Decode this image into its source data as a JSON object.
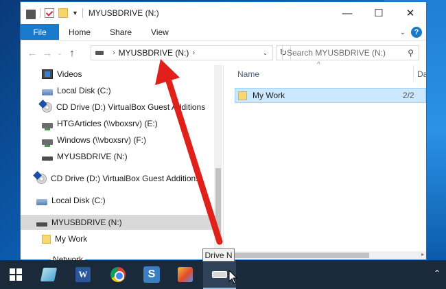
{
  "window": {
    "title": "MYUSBDRIVE (N:)",
    "controls": {
      "minimize": "—",
      "maximize": "☐",
      "close": "✕"
    }
  },
  "ribbon": {
    "file": "File",
    "tabs": [
      "Home",
      "Share",
      "View"
    ],
    "help": "?"
  },
  "navigation": {
    "address_crumb": "MYUSBDRIVE (N:)",
    "search_placeholder": "Search MYUSBDRIVE (N:)"
  },
  "nav_pane": {
    "items": [
      {
        "label": "Videos",
        "icon": "videos-icon"
      },
      {
        "label": "Local Disk (C:)",
        "icon": "local-disk-icon"
      },
      {
        "label": "CD Drive (D:) VirtualBox Guest Additions",
        "icon": "cd-drive-icon"
      },
      {
        "label": "HTGArticles (\\\\vboxsrv) (E:)",
        "icon": "network-drive-icon"
      },
      {
        "label": "Windows (\\\\vboxsrv) (F:)",
        "icon": "network-drive-icon"
      },
      {
        "label": "MYUSBDRIVE (N:)",
        "icon": "usb-drive-icon"
      },
      {
        "label": "CD Drive (D:) VirtualBox Guest Additions",
        "icon": "cd-drive-icon"
      },
      {
        "label": "Local Disk (C:)",
        "icon": "local-disk-icon"
      },
      {
        "label": "MYUSBDRIVE (N:)",
        "icon": "usb-drive-icon",
        "selected": true
      },
      {
        "label": "My Work",
        "icon": "folder-icon"
      },
      {
        "label": "Network",
        "icon": "network-icon"
      }
    ]
  },
  "content": {
    "columns": {
      "name": "Name",
      "date": "Dat"
    },
    "files": [
      {
        "name": "My Work",
        "date": "2/2"
      }
    ]
  },
  "tooltip": "Drive N",
  "taskbar": {
    "apps": [
      "start-button",
      "glass-app",
      "word-app",
      "chrome-app",
      "snagit-app",
      "paint-app",
      "usb-drive-app"
    ]
  },
  "colors": {
    "accent": "#1979ca",
    "arrow": "#e0201b",
    "taskbar": "#1b2a3a",
    "selection": "#cce8ff"
  }
}
